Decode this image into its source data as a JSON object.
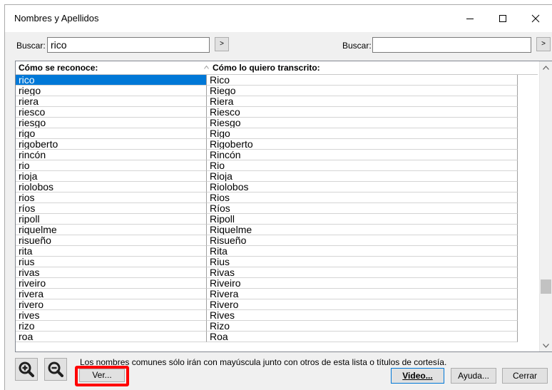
{
  "window": {
    "title": "Nombres y Apellidos"
  },
  "search_left": {
    "label": "Buscar:",
    "value": "rico",
    "button_label": ">"
  },
  "search_right": {
    "label": "Buscar:",
    "value": "",
    "button_label": ">"
  },
  "table": {
    "columns": [
      "Cómo se reconoce:",
      "Cómo lo quiero transcrito:"
    ],
    "rows": [
      [
        "rico",
        "Rico"
      ],
      [
        "riego",
        "Riego"
      ],
      [
        "riera",
        "Riera"
      ],
      [
        "riesco",
        "Riesco"
      ],
      [
        "riesgo",
        "Riesgo"
      ],
      [
        "rigo",
        "Rigo"
      ],
      [
        "rigoberto",
        "Rigoberto"
      ],
      [
        "rincón",
        "Rincón"
      ],
      [
        "rio",
        "Rio"
      ],
      [
        "rioja",
        "Rioja"
      ],
      [
        "riolobos",
        "Riolobos"
      ],
      [
        "rios",
        "Rios"
      ],
      [
        "ríos",
        "Ríos"
      ],
      [
        "ripoll",
        "Ripoll"
      ],
      [
        "riquelme",
        "Riquelme"
      ],
      [
        "risueño",
        "Risueño"
      ],
      [
        "rita",
        "Rita"
      ],
      [
        "rius",
        "Rius"
      ],
      [
        "rivas",
        "Rivas"
      ],
      [
        "riveiro",
        "Riveiro"
      ],
      [
        "rivera",
        "Rivera"
      ],
      [
        "rivero",
        "Rivero"
      ],
      [
        "rives",
        "Rives"
      ],
      [
        "rizo",
        "Rizo"
      ],
      [
        "roa",
        "Roa"
      ]
    ],
    "selected_row": 0
  },
  "footer": {
    "note": "Los nombres comunes sólo irán con mayúscula junto con otros de esta lista o títulos de cortesía.",
    "ver_label": "Ver...",
    "video_label": "Video...",
    "ayuda_label": "Ayuda...",
    "cerrar_label": "Cerrar"
  },
  "icons": [
    "minimize-icon",
    "maximize-icon",
    "close-icon",
    "zoom-in-icon",
    "zoom-out-icon",
    "sort-ascending-icon",
    "scroll-up-icon",
    "scroll-down-icon"
  ],
  "colors": {
    "selection": "#0078d7",
    "highlight": "#ff0000",
    "window_bg": "#f0f0f0"
  }
}
